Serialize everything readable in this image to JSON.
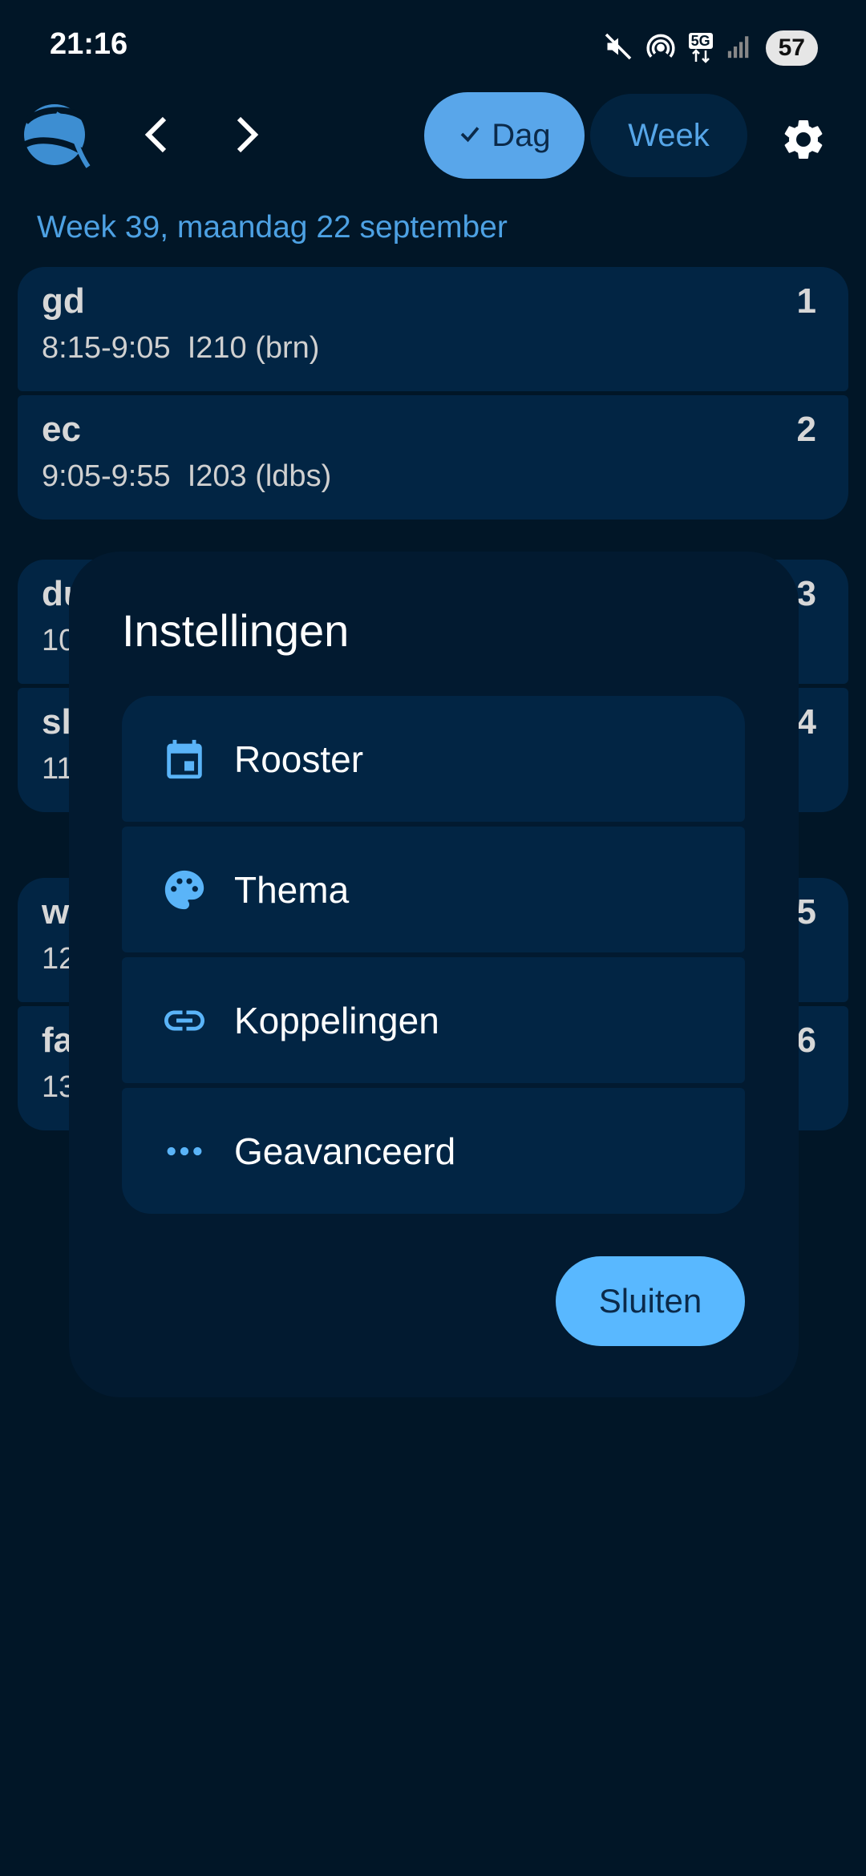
{
  "status_bar": {
    "time": "21:16",
    "network": "5G",
    "battery": "57",
    "icons": [
      "mute-icon",
      "hotspot-icon",
      "5g-data-icon",
      "signal-icon"
    ]
  },
  "toolbar": {
    "logo": "app-logo",
    "prev_icon": "chevron-left-icon",
    "next_icon": "chevron-right-icon",
    "view_day_label": "Dag",
    "view_week_label": "Week",
    "settings_icon": "gear-icon"
  },
  "schedule": {
    "date_heading": "Week 39, maandag 22 september",
    "lessons": [
      {
        "subject": "gd",
        "details": "8:15-9:05  I210 (brn)",
        "number": "1"
      },
      {
        "subject": "ec",
        "details": "9:05-9:55  I203 (ldbs)",
        "number": "2"
      },
      {
        "subject": "du",
        "details": "10",
        "number": "3"
      },
      {
        "subject": "sl",
        "details": "11",
        "number": "4"
      },
      {
        "subject": "w",
        "details": "12",
        "number": "5"
      },
      {
        "subject": "fa",
        "details": "13",
        "number": "6"
      }
    ]
  },
  "settings_dialog": {
    "title": "Instellingen",
    "items": [
      {
        "label": "Rooster",
        "icon": "calendar-icon"
      },
      {
        "label": "Thema",
        "icon": "palette-icon"
      },
      {
        "label": "Koppelingen",
        "icon": "link-icon"
      },
      {
        "label": "Geavanceerd",
        "icon": "more-horiz-icon"
      }
    ],
    "close_label": "Sluiten"
  },
  "colors": {
    "background": "#011627",
    "card": "#022544",
    "dialog": "#021a30",
    "accent": "#59a6ea",
    "heading_blue": "#4da1e3"
  }
}
